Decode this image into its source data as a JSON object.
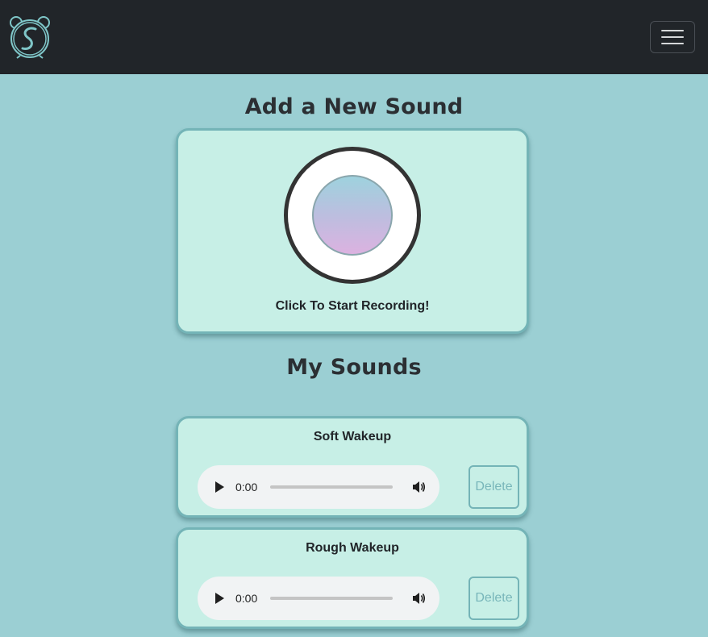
{
  "navbar": {
    "logo_icon": "alarm-clock-logo-icon",
    "menu_icon": "hamburger-menu-icon"
  },
  "record_section": {
    "title": "Add a New Sound",
    "button_label": "Click To Start Recording!"
  },
  "sounds_section": {
    "title": "My Sounds",
    "items": [
      {
        "name": "Soft Wakeup",
        "time": "0:00",
        "delete_label": "Delete"
      },
      {
        "name": "Rough Wakeup",
        "time": "0:00",
        "delete_label": "Delete"
      }
    ]
  },
  "colors": {
    "background": "#9bcfd3",
    "navbar": "#212529",
    "card": "#c7efe6",
    "card_border": "#74b4b7",
    "delete_text": "#78b6ba"
  }
}
